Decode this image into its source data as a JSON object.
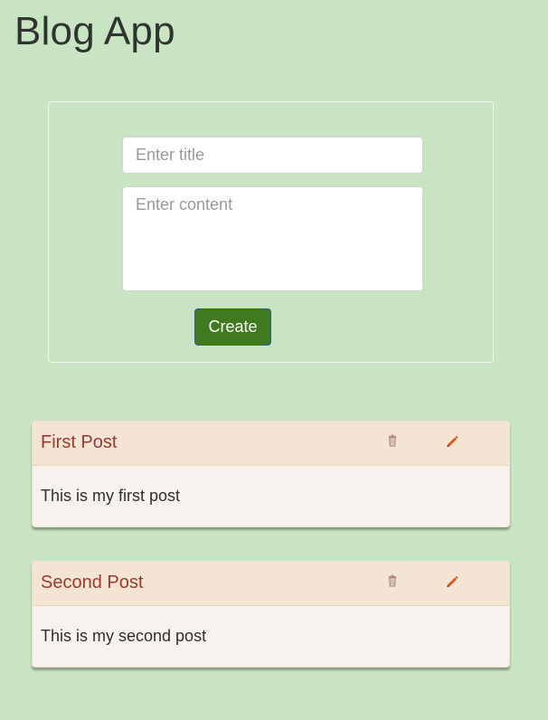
{
  "app": {
    "title": "Blog App"
  },
  "form": {
    "title_placeholder": "Enter title",
    "title_value": "",
    "content_placeholder": "Enter content",
    "content_value": "",
    "create_label": "Create"
  },
  "posts": [
    {
      "title": "First Post",
      "content": "This is my first post",
      "delete_icon": "trash-icon",
      "edit_icon": "pencil-icon"
    },
    {
      "title": "Second Post",
      "content": "This is my second post",
      "delete_icon": "trash-icon",
      "edit_icon": "pencil-icon"
    }
  ],
  "colors": {
    "background": "#c8e4c2",
    "card_header": "#f3e4d4",
    "card_body": "#f8f2ee",
    "post_title": "#9a3a2e",
    "create_button": "#3f7a1f",
    "edit_icon": "#e0541a",
    "delete_icon": "#b08a84"
  }
}
